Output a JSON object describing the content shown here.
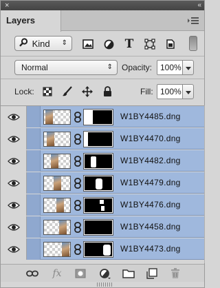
{
  "window": {
    "close_glyph": "×",
    "collapse_glyph": "«"
  },
  "tabs": [
    {
      "label": "Layers"
    }
  ],
  "filter": {
    "kind_label": "Kind",
    "kind_arrows": "⇕",
    "icons": [
      "image-filter-icon",
      "adjustment-filter-icon",
      "type-filter-icon",
      "shape-filter-icon",
      "smart-object-filter-icon"
    ],
    "type_glyph": "T"
  },
  "blend": {
    "mode": "Normal",
    "arrows": "⇕",
    "opacity_label": "Opacity:",
    "opacity_value": "100%"
  },
  "lock": {
    "label": "Lock:",
    "fill_label": "Fill:",
    "fill_value": "100%",
    "icons": [
      "lock-transparent-pixels-icon",
      "lock-image-pixels-icon",
      "lock-position-icon",
      "lock-all-icon"
    ]
  },
  "layers": [
    {
      "name": "W1BY4485.dng"
    },
    {
      "name": "W1BY4470.dng"
    },
    {
      "name": "W1BY4482.dng"
    },
    {
      "name": "W1BY4479.dng"
    },
    {
      "name": "W1BY4476.dng"
    },
    {
      "name": "W1BY4458.dng"
    },
    {
      "name": "W1BY4473.dng"
    }
  ],
  "footer": {
    "fx_label": "fx",
    "icons": [
      "link-layers-icon",
      "layer-style-icon",
      "add-mask-icon",
      "adjustment-layer-icon",
      "new-group-icon",
      "new-layer-icon",
      "delete-layer-icon"
    ]
  },
  "colors": {
    "selected_row": "#9fb8dd",
    "panel_bg": "#d6d6d6"
  }
}
